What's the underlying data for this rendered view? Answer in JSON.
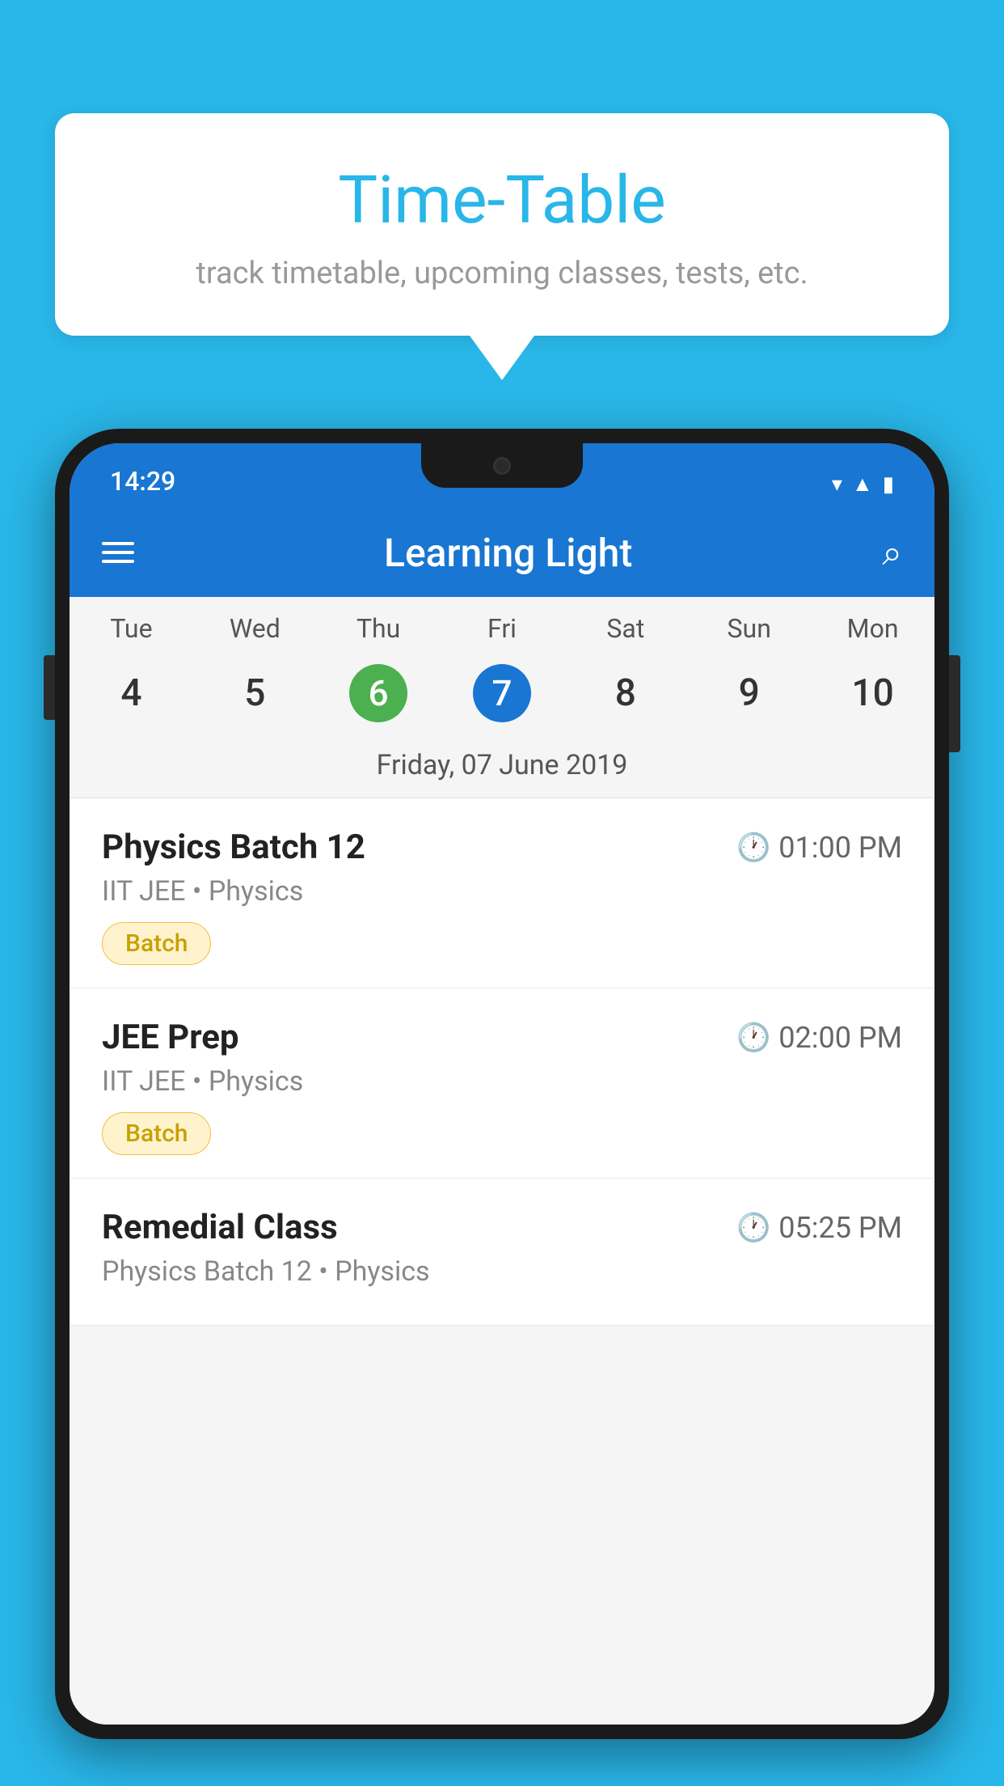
{
  "background_color": "#29B6E8",
  "speech_bubble": {
    "title": "Time-Table",
    "subtitle": "track timetable, upcoming classes, tests, etc."
  },
  "phone": {
    "status_bar": {
      "time": "14:29"
    },
    "app_bar": {
      "title": "Learning Light"
    },
    "calendar": {
      "days": [
        "Tue",
        "Wed",
        "Thu",
        "Fri",
        "Sat",
        "Sun",
        "Mon"
      ],
      "dates": [
        "4",
        "5",
        "6",
        "7",
        "8",
        "9",
        "10"
      ],
      "today_index": 2,
      "selected_index": 3,
      "selected_date_label": "Friday, 07 June 2019"
    },
    "schedule": [
      {
        "title": "Physics Batch 12",
        "time": "01:00 PM",
        "subtitle": "IIT JEE • Physics",
        "badge": "Batch"
      },
      {
        "title": "JEE Prep",
        "time": "02:00 PM",
        "subtitle": "IIT JEE • Physics",
        "badge": "Batch"
      },
      {
        "title": "Remedial Class",
        "time": "05:25 PM",
        "subtitle": "Physics Batch 12 • Physics",
        "badge": ""
      }
    ]
  }
}
